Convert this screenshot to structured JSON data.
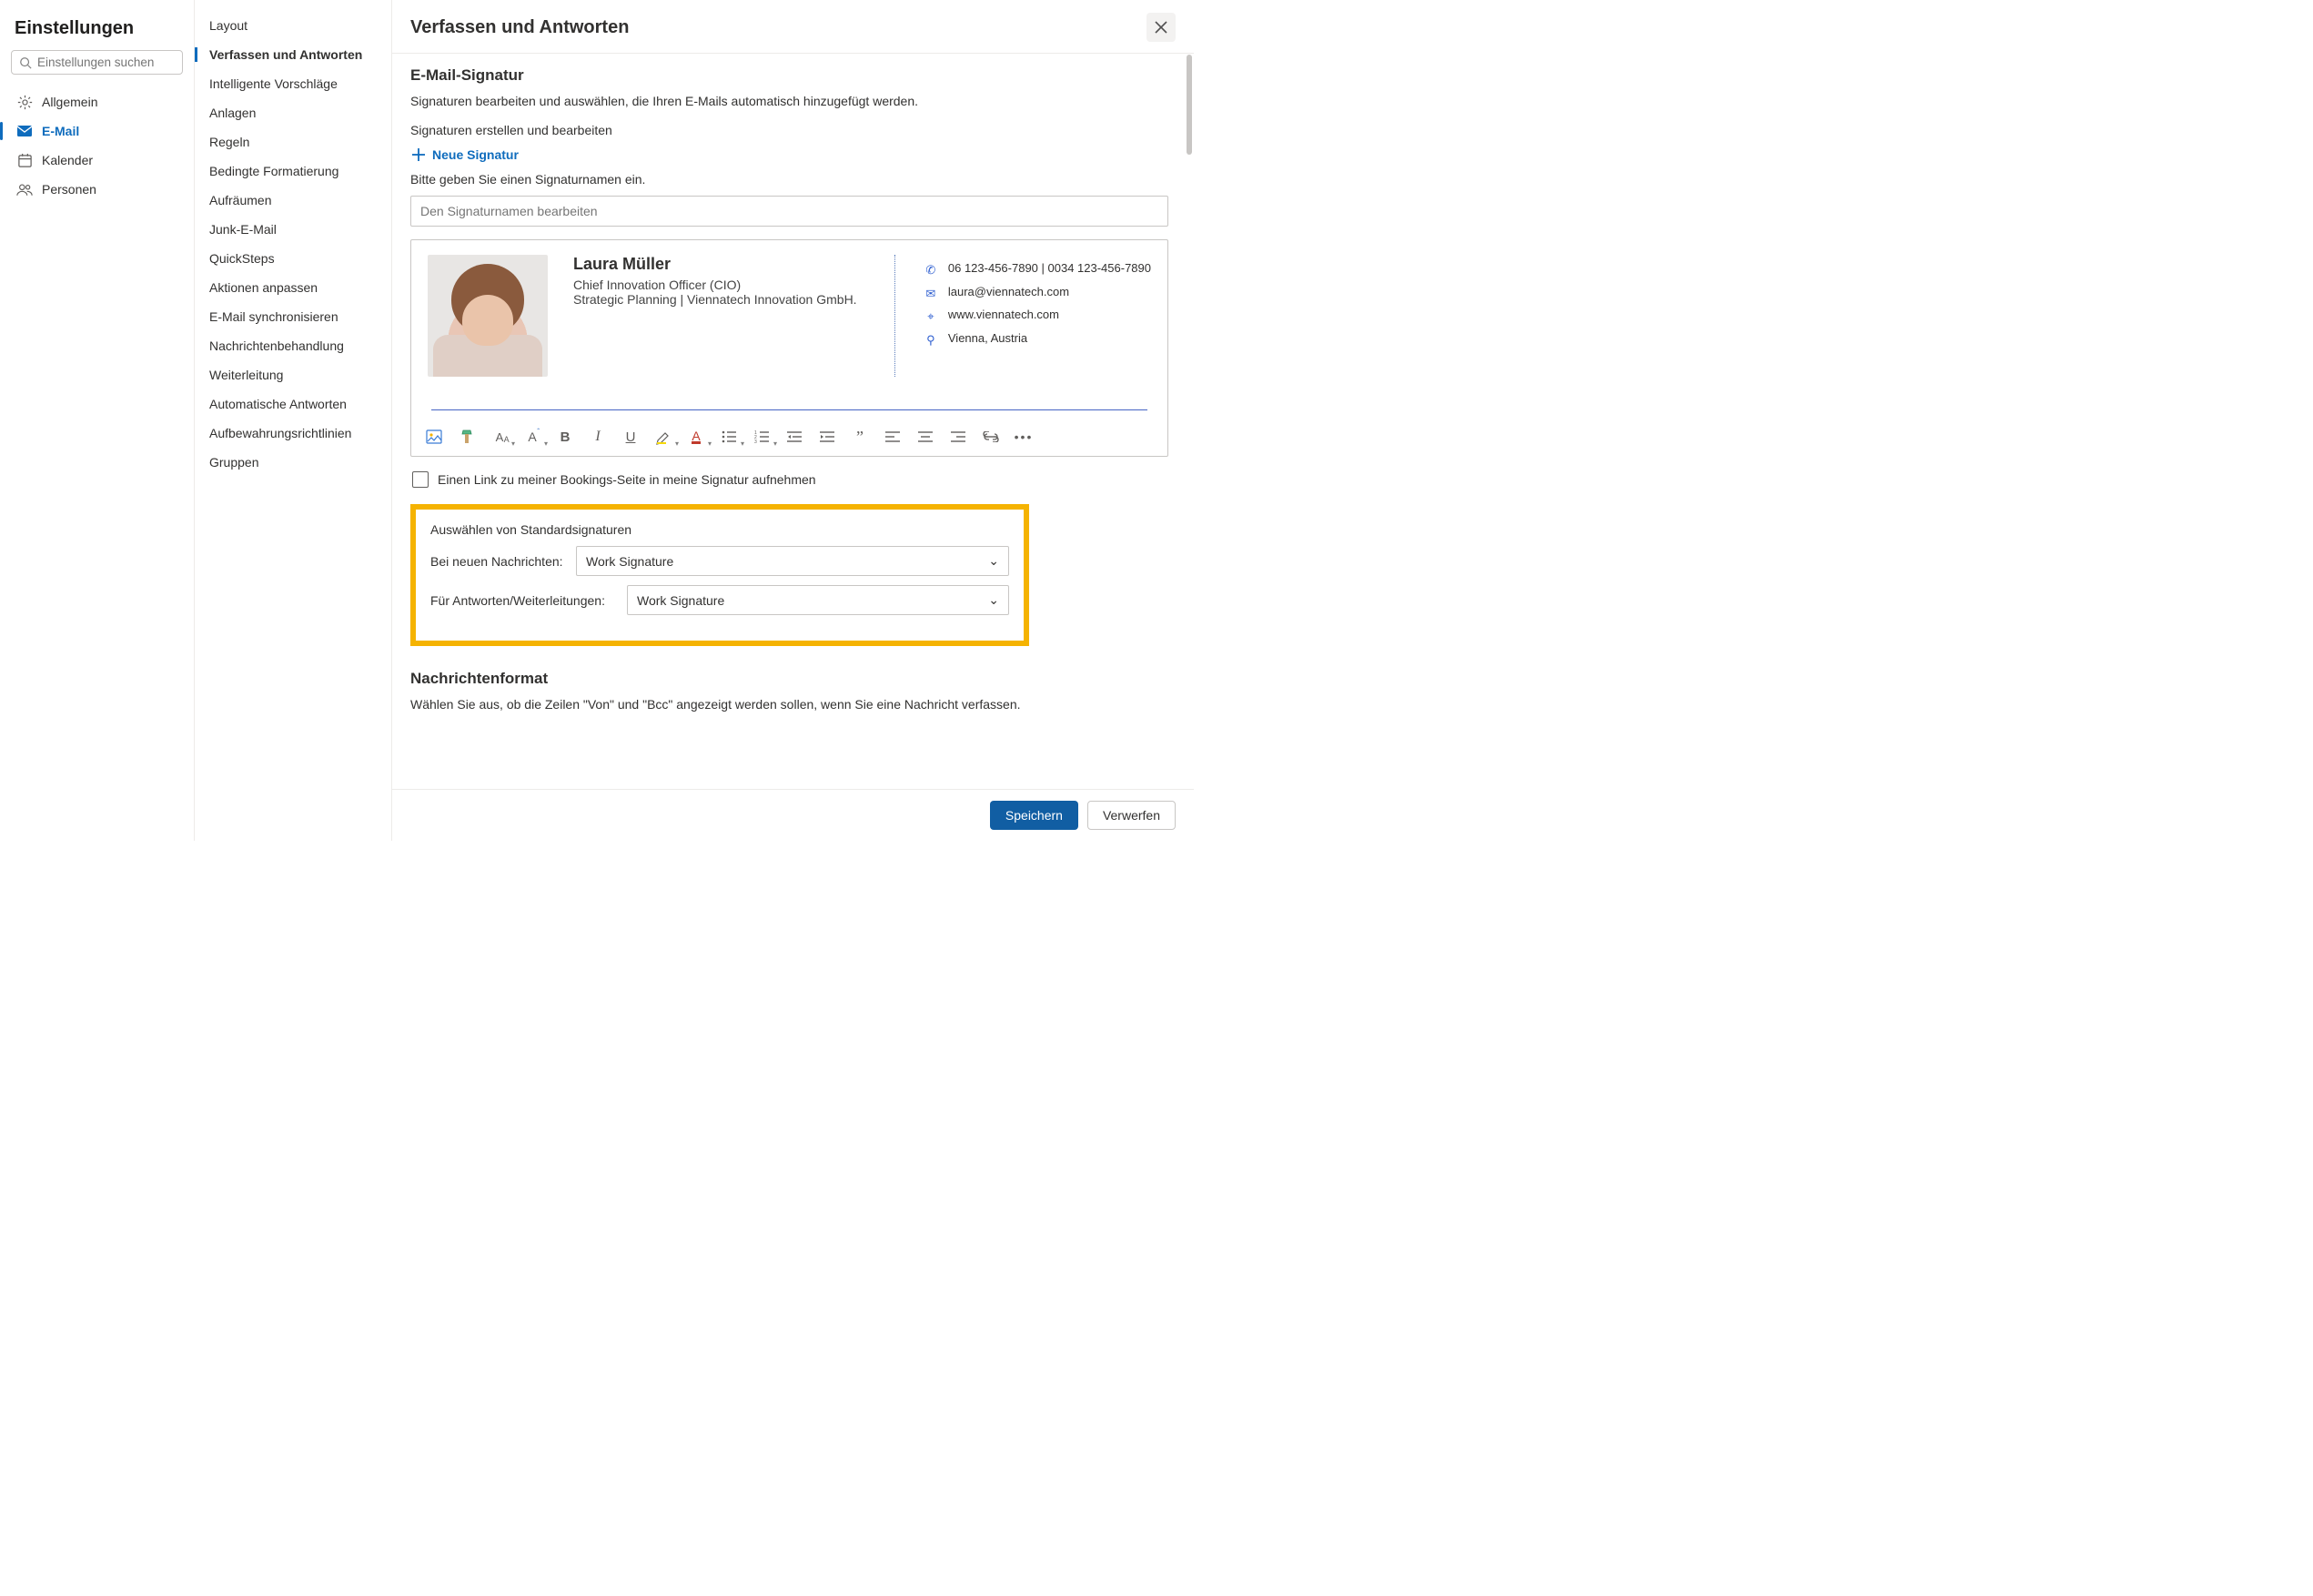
{
  "col1": {
    "title": "Einstellungen",
    "search_placeholder": "Einstellungen suchen",
    "categories": [
      {
        "icon": "gear",
        "label": "Allgemein",
        "selected": false
      },
      {
        "icon": "mail",
        "label": "E-Mail",
        "selected": true
      },
      {
        "icon": "calendar",
        "label": "Kalender",
        "selected": false
      },
      {
        "icon": "people",
        "label": "Personen",
        "selected": false
      }
    ]
  },
  "col2": {
    "items": [
      {
        "label": "Layout",
        "selected": false
      },
      {
        "label": "Verfassen und Antworten",
        "selected": true
      },
      {
        "label": "Intelligente Vorschläge",
        "selected": false
      },
      {
        "label": "Anlagen",
        "selected": false
      },
      {
        "label": "Regeln",
        "selected": false
      },
      {
        "label": "Bedingte Formatierung",
        "selected": false
      },
      {
        "label": "Aufräumen",
        "selected": false
      },
      {
        "label": "Junk-E-Mail",
        "selected": false
      },
      {
        "label": "QuickSteps",
        "selected": false
      },
      {
        "label": "Aktionen anpassen",
        "selected": false
      },
      {
        "label": "E-Mail synchronisieren",
        "selected": false
      },
      {
        "label": "Nachrichtenbehandlung",
        "selected": false
      },
      {
        "label": "Weiterleitung",
        "selected": false
      },
      {
        "label": "Automatische Antworten",
        "selected": false
      },
      {
        "label": "Aufbewahrungsrichtlinien",
        "selected": false
      },
      {
        "label": "Gruppen",
        "selected": false
      }
    ]
  },
  "main": {
    "title": "Verfassen und Antworten",
    "sig_heading": "E-Mail-Signatur",
    "sig_desc": "Signaturen bearbeiten und auswählen, die Ihren E-Mails automatisch hinzugefügt werden.",
    "sig_create_edit": "Signaturen erstellen und bearbeiten",
    "new_signature": "Neue Signatur",
    "sig_name_prompt": "Bitte geben Sie einen Signaturnamen ein.",
    "sig_name_placeholder": "Den Signaturnamen bearbeiten",
    "bookings_label": "Einen Link zu meiner Bookings-Seite in meine Signatur aufnehmen",
    "defaults_heading": "Auswählen von Standardsignaturen",
    "for_new_label": "Bei neuen Nachrichten:",
    "for_new_value": "Work Signature",
    "for_reply_label": "Für Antworten/Weiterleitungen:",
    "for_reply_value": "Work Signature",
    "msgfmt_heading": "Nachrichtenformat",
    "msgfmt_desc": "Wählen Sie aus, ob die Zeilen \"Von\" und \"Bcc\" angezeigt werden sollen, wenn Sie eine Nachricht verfassen.",
    "save": "Speichern",
    "discard": "Verwerfen"
  },
  "signature": {
    "name": "Laura Müller",
    "role": "Chief Innovation Officer (CIO)",
    "dept": "Strategic Planning | Viennatech Innovation GmbH.",
    "phone": "06 123-456-7890 | 0034 123-456-7890",
    "email": "laura@viennatech.com",
    "web": "www.viennatech.com",
    "location": "Vienna, Austria"
  },
  "toolbar": {
    "items": [
      {
        "name": "insert-image-icon"
      },
      {
        "name": "format-painter-icon"
      },
      {
        "name": "font-family-icon"
      },
      {
        "name": "font-size-icon"
      },
      {
        "name": "bold-icon"
      },
      {
        "name": "italic-icon"
      },
      {
        "name": "underline-icon"
      },
      {
        "name": "highlight-icon"
      },
      {
        "name": "font-color-icon"
      },
      {
        "name": "bullet-list-icon"
      },
      {
        "name": "number-list-icon"
      },
      {
        "name": "indent-decrease-icon"
      },
      {
        "name": "indent-increase-icon"
      },
      {
        "name": "quote-icon"
      },
      {
        "name": "align-left-icon"
      },
      {
        "name": "align-center-icon"
      },
      {
        "name": "align-right-icon"
      },
      {
        "name": "insert-link-icon"
      },
      {
        "name": "more-icon"
      }
    ]
  }
}
